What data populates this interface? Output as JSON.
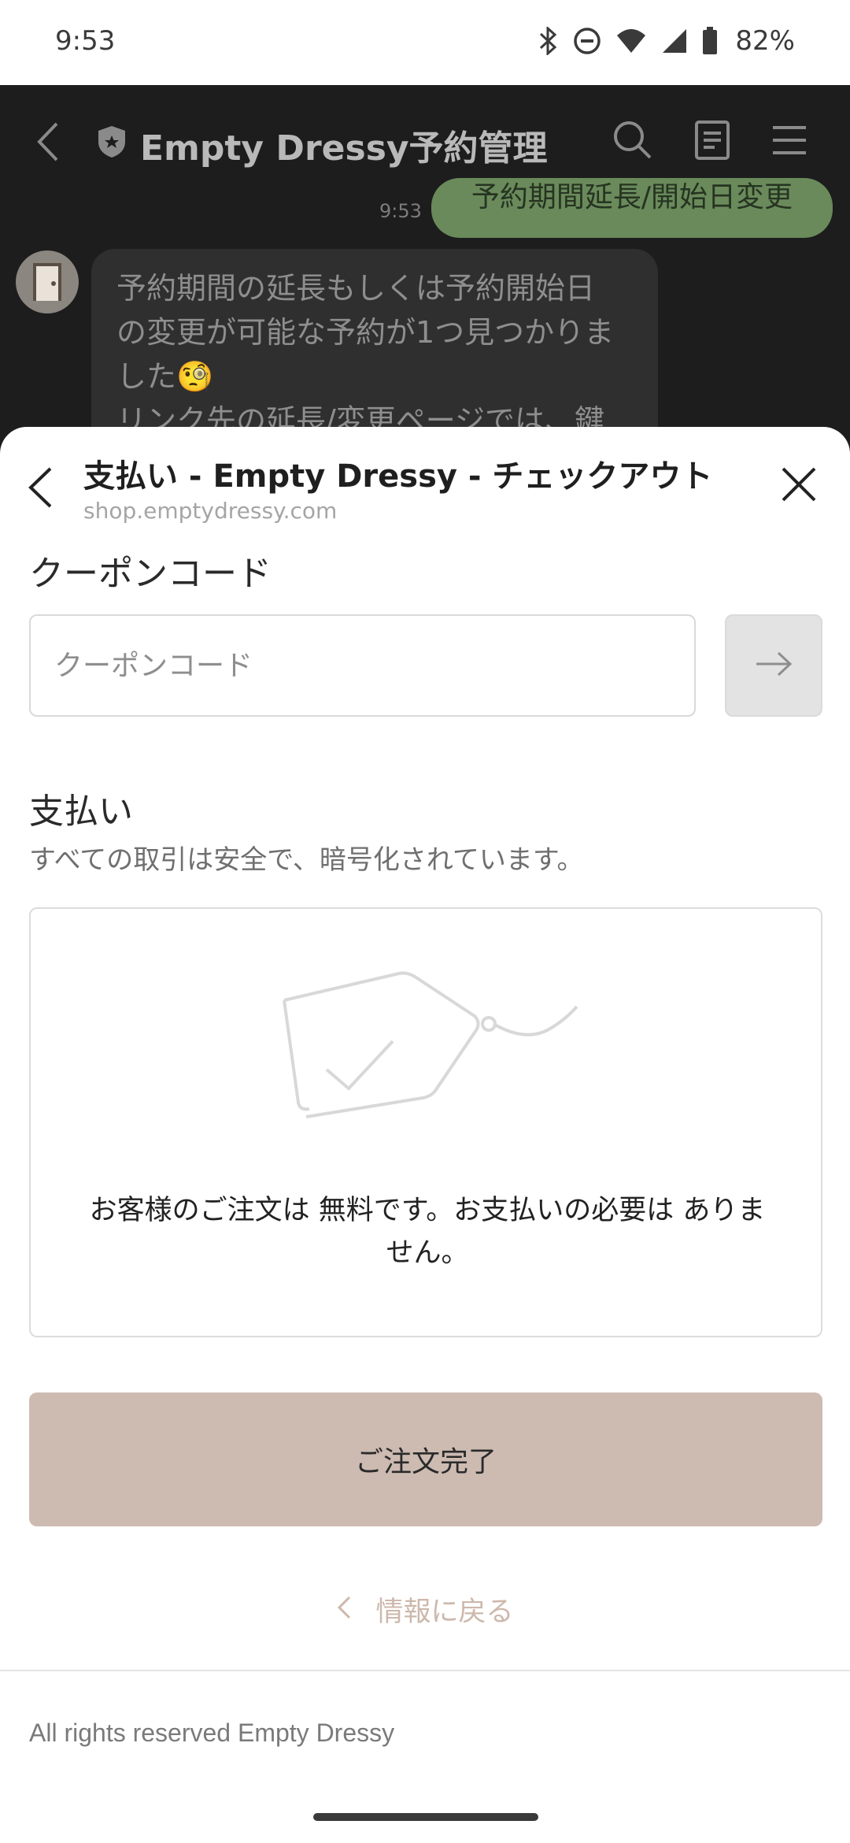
{
  "status_bar": {
    "time": "9:53",
    "battery": "82%",
    "icons": [
      "bluetooth-icon",
      "do-not-disturb-icon",
      "wifi-icon",
      "signal-icon",
      "battery-icon"
    ]
  },
  "chat": {
    "header_title": "Empty Dressy予約管理",
    "sent_message": "予約期間延長/開始日変更",
    "sent_time": "9:53",
    "received_lines": [
      "予約期間の延長もしくは予約開始日",
      "の変更が可能な予約が1つ見つかりま",
      "した🧐",
      "リンク先の延長/変更ページでは、鍵"
    ]
  },
  "sheet": {
    "title": "支払い - Empty Dressy - チェックアウト",
    "url": "shop.emptydressy.com",
    "coupon_heading": "クーポンコード",
    "coupon_placeholder": "クーポンコード",
    "payment_heading": "支払い",
    "payment_sub": "すべての取引は安全で、暗号化されています。",
    "free_message": "お客様のご注文は 無料です。お支払いの必要は ありません。",
    "complete_button": "ご注文完了",
    "back_link": "情報に戻る",
    "footer": "All rights reserved Empty Dressy"
  },
  "colors": {
    "chat_bg": "#1d1d1d",
    "sent_bubble": "#6a8a5b",
    "complete_button": "#cdbbb2",
    "back_link": "#cdb8ac"
  }
}
